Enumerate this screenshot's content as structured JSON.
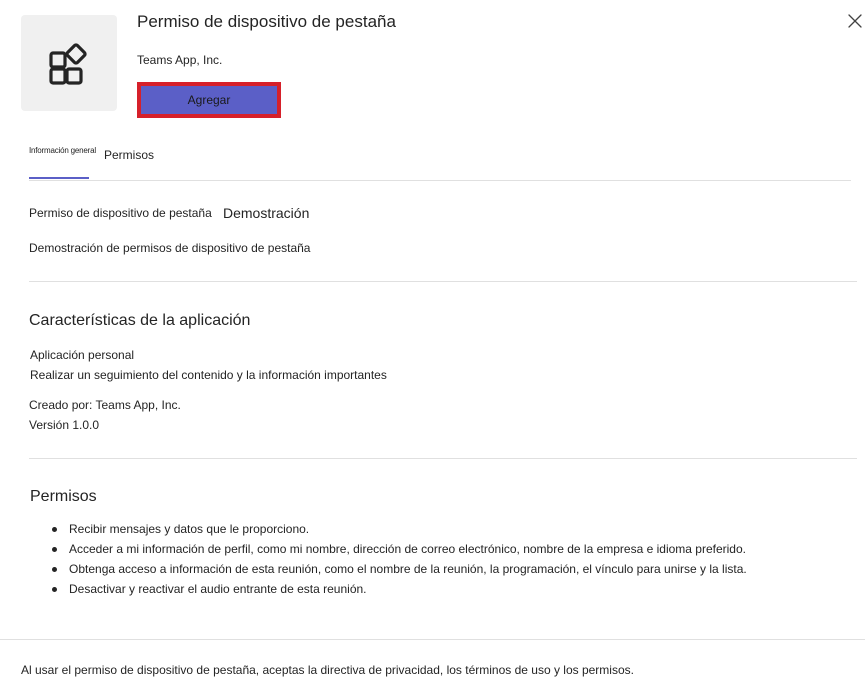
{
  "header": {
    "app_name": "Permiso de dispositivo de pestaña",
    "publisher": "Teams App, Inc.",
    "add_label": "Agregar"
  },
  "tabs": [
    {
      "label": "Información general",
      "selected": true
    },
    {
      "label": "Permisos",
      "selected": false
    }
  ],
  "overview": {
    "title": "Permiso de dispositivo de pestaña",
    "title_suffix": "Demostración",
    "description": "Demostración de permisos de dispositivo de pestaña"
  },
  "features": {
    "heading": "Características de la aplicación",
    "type": "Aplicación personal",
    "tagline": "Realizar un seguimiento del contenido y la información importantes",
    "created_by": "Creado por: Teams App, Inc.",
    "version": "Versión 1.0.0"
  },
  "permissions": {
    "heading": "Permisos",
    "items": [
      "Recibir mensajes y datos que le proporciono.",
      "Acceder a mi información de perfil, como mi nombre, dirección de correo electrónico, nombre de la empresa e idioma preferido.",
      "Obtenga acceso a información de esta reunión, como el nombre de la reunión, la programación, el vínculo para unirse y la lista.",
      "Desactivar y reactivar el audio entrante de esta reunión."
    ]
  },
  "footer": {
    "text": "Al usar el permiso de dispositivo de pestaña, aceptas la directiva de privacidad, los términos de uso y los permisos."
  },
  "colors": {
    "accent": "#5b5fc7",
    "highlight_border": "#d6202a",
    "icon_tile": "#f0f0f0",
    "divider": "#e0e0e0"
  },
  "icons": {
    "app": "apps-grid-icon",
    "close": "close-icon"
  }
}
